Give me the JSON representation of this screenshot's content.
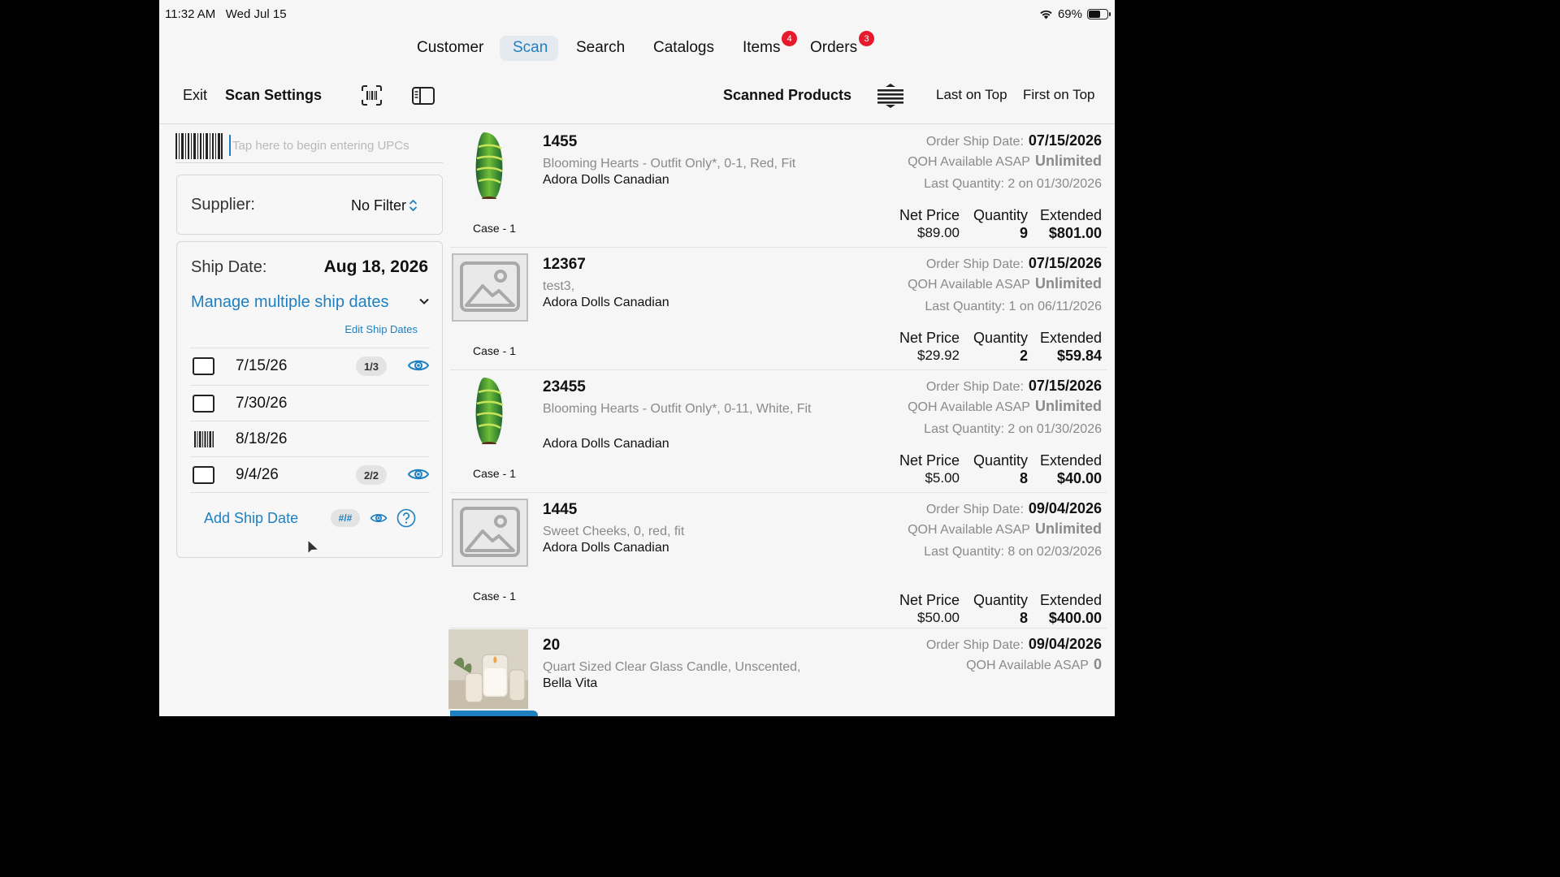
{
  "status_bar": {
    "time": "11:32 AM",
    "date": "Wed Jul 15",
    "battery": "69%",
    "battery_fraction": 0.69
  },
  "tabs": [
    {
      "label": "Customer"
    },
    {
      "label": "Scan",
      "active": true
    },
    {
      "label": "Search"
    },
    {
      "label": "Catalogs"
    },
    {
      "label": "Items",
      "badge": "4"
    },
    {
      "label": "Orders",
      "badge": "3"
    }
  ],
  "toolbar": {
    "exit": "Exit",
    "scan_settings": "Scan Settings",
    "scanned_products": "Scanned Products",
    "last_on_top": "Last on Top",
    "first_on_top": "First on Top"
  },
  "upc": {
    "placeholder": "Tap here to begin entering UPCs",
    "value": ""
  },
  "supplier": {
    "label": "Supplier:",
    "value": "No Filter"
  },
  "ship": {
    "label": "Ship Date:",
    "value": "Aug 18, 2026",
    "manage": "Manage multiple ship dates",
    "edit": "Edit Ship Dates",
    "dates": [
      {
        "date": "7/15/26",
        "count": "1/3",
        "visible": true,
        "icon": "checkbox"
      },
      {
        "date": "7/30/26",
        "count": "",
        "visible": false,
        "icon": "checkbox"
      },
      {
        "date": "8/18/26",
        "count": "",
        "visible": false,
        "icon": "barcode-icon"
      },
      {
        "date": "9/4/26",
        "count": "2/2",
        "visible": true,
        "icon": "checkbox"
      }
    ],
    "add": "Add Ship Date",
    "hash": "#/#"
  },
  "products": [
    {
      "code": "1455",
      "desc": "Blooming Hearts - Outfit Only*, 0-1, Red, Fit",
      "supplier": "Adora Dolls Canadian",
      "case": "Case - 1",
      "image": "green-vase",
      "order_ship_label": "Order Ship Date:",
      "order_ship_date": "07/15/2026",
      "qoh_label": "QOH Available ASAP",
      "qoh_value": "Unlimited",
      "last_qty": "Last Quantity: 2 on 01/30/2026",
      "net_price": "$89.00",
      "quantity": "9",
      "extended": "$801.00"
    },
    {
      "code": "12367",
      "desc": "test3,",
      "supplier": "Adora Dolls Canadian",
      "case": "Case - 1",
      "image": "placeholder",
      "order_ship_label": "Order Ship Date:",
      "order_ship_date": "07/15/2026",
      "qoh_label": "QOH Available ASAP",
      "qoh_value": "Unlimited",
      "last_qty": "Last Quantity: 1 on 06/11/2026",
      "net_price": "$29.92",
      "quantity": "2",
      "extended": "$59.84"
    },
    {
      "code": "23455",
      "desc": "Blooming Hearts - Outfit Only*, 0-11, White, Fit",
      "supplier": "Adora Dolls Canadian",
      "case": "Case - 1",
      "image": "green-vase",
      "order_ship_label": "Order Ship Date:",
      "order_ship_date": "07/15/2026",
      "qoh_label": "QOH Available ASAP",
      "qoh_value": "Unlimited",
      "last_qty": "Last Quantity: 2 on 01/30/2026",
      "net_price": "$5.00",
      "quantity": "8",
      "extended": "$40.00"
    },
    {
      "code": "1445",
      "desc": "Sweet Cheeks, 0, red, fit",
      "supplier": "Adora Dolls Canadian",
      "case": "Case - 1",
      "image": "placeholder",
      "order_ship_label": "Order Ship Date:",
      "order_ship_date": "09/04/2026",
      "qoh_label": "QOH Available ASAP",
      "qoh_value": "Unlimited",
      "last_qty": "Last Quantity: 8 on 02/03/2026",
      "net_price": "$50.00",
      "quantity": "8",
      "extended": "$400.00"
    },
    {
      "code": "20",
      "desc": "Quart Sized Clear Glass Candle, Unscented,",
      "supplier": "Bella Vita",
      "case": "",
      "image": "candle",
      "order_ship_label": "Order Ship Date:",
      "order_ship_date": "09/04/2026",
      "qoh_label": "QOH Available ASAP",
      "qoh_value": "0",
      "last_qty": "",
      "net_price": "",
      "quantity": "",
      "extended": ""
    }
  ],
  "price_headers": {
    "net": "Net Price",
    "qty": "Quantity",
    "ext": "Extended"
  },
  "colors": {
    "accent": "#1e7fc1",
    "badge": "#e8192c"
  }
}
